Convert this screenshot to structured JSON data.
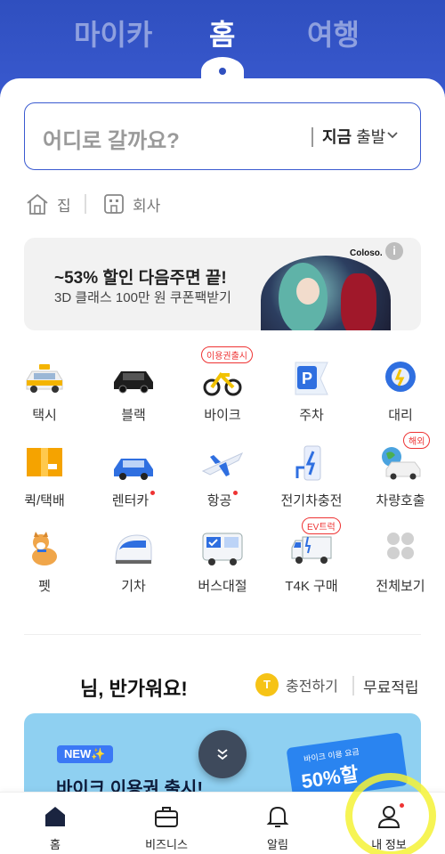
{
  "top_tabs": [
    {
      "label": "마이카",
      "active": false
    },
    {
      "label": "홈",
      "active": true
    },
    {
      "label": "여행",
      "active": false
    }
  ],
  "search": {
    "placeholder": "어디로 갈까요?",
    "depart_bold": "지금",
    "depart_rest": " 출발"
  },
  "quick_places": {
    "home_label": "집",
    "work_label": "회사"
  },
  "banner": {
    "title": "~53% 할인 다음주면 끝!",
    "subtitle": "3D 클래스 100만 원 쿠폰팩받기",
    "brand": "Coloso.",
    "info": "i"
  },
  "services": [
    {
      "label": "택시",
      "icon": "taxi-icon"
    },
    {
      "label": "블랙",
      "icon": "black-car-icon"
    },
    {
      "label": "바이크",
      "icon": "bike-icon",
      "tag": "이용권출시"
    },
    {
      "label": "주차",
      "icon": "parking-icon"
    },
    {
      "label": "대리",
      "icon": "steering-wheel-icon"
    },
    {
      "label": "퀵/택배",
      "icon": "box-icon"
    },
    {
      "label": "렌터카",
      "icon": "rental-car-icon",
      "dot": true
    },
    {
      "label": "항공",
      "icon": "airplane-icon",
      "dot": true
    },
    {
      "label": "전기차충전",
      "icon": "ev-charger-icon"
    },
    {
      "label": "차량호출",
      "icon": "car-call-icon",
      "tag": "해외"
    },
    {
      "label": "펫",
      "icon": "pet-icon"
    },
    {
      "label": "기차",
      "icon": "train-icon"
    },
    {
      "label": "버스대절",
      "icon": "bus-icon"
    },
    {
      "label": "T4K 구매",
      "icon": "truck-icon",
      "tag": "EV트럭"
    },
    {
      "label": "전체보기",
      "icon": "grid-icon"
    }
  ],
  "greeting": {
    "text": "님, 반가워요!",
    "coin": "T",
    "charge_label": "충전하기",
    "free_label": "무료적립"
  },
  "promo": {
    "badge": "NEW✨",
    "title": "바이크 이용권 출시!",
    "ticket_small": "바이크 이용 요금",
    "ticket_big": "50%할"
  },
  "bottom_nav": [
    {
      "label": "홈",
      "icon": "home-icon"
    },
    {
      "label": "비즈니스",
      "icon": "briefcase-icon"
    },
    {
      "label": "알림",
      "icon": "bell-icon"
    },
    {
      "label": "내 정보",
      "icon": "user-icon"
    }
  ],
  "colors": {
    "brand": "#3a5ad0",
    "alert": "#e33333",
    "highlight": "#f5f236"
  }
}
